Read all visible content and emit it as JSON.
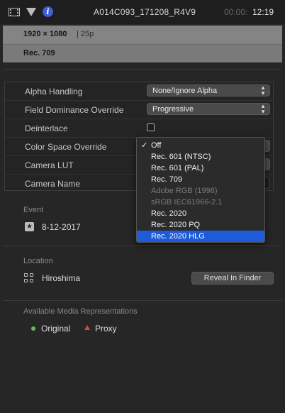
{
  "topbar": {
    "clip_title": "A014C093_171208_R4V9",
    "timecode_dim": "00:00:",
    "timecode": "12:19",
    "icons": [
      "film-icon",
      "filter-triangle-icon",
      "info-icon"
    ]
  },
  "summary": {
    "resolution": "1920 × 1080",
    "frame_rate": "| 25p",
    "color_space": "Rec. 709"
  },
  "settings": {
    "alpha_label": "Alpha Handling",
    "alpha_value": "None/Ignore Alpha",
    "field_label": "Field Dominance Override",
    "field_value": "Progressive",
    "deinterlace_label": "Deinterlace",
    "colorspace_label": "Color Space Override",
    "lut_label": "Camera LUT",
    "camname_label": "Camera Name"
  },
  "menu": {
    "check_mark": "✓",
    "items": [
      {
        "label": "Off",
        "state": "checked"
      },
      {
        "label": "Rec. 601 (NTSC)",
        "state": "enabled"
      },
      {
        "label": "Rec. 601 (PAL)",
        "state": "enabled"
      },
      {
        "label": "Rec. 709",
        "state": "enabled"
      },
      {
        "label": "Adobe RGB (1998)",
        "state": "disabled"
      },
      {
        "label": "sRGB IEC61966-2.1",
        "state": "disabled"
      },
      {
        "label": "Rec. 2020",
        "state": "enabled"
      },
      {
        "label": "Rec. 2020 PQ",
        "state": "enabled"
      },
      {
        "label": "Rec. 2020 HLG",
        "state": "highlighted"
      }
    ]
  },
  "event": {
    "label": "Event",
    "value": "8-12-2017"
  },
  "location": {
    "label": "Location",
    "value": "Hiroshima",
    "reveal_button": "Reveal In Finder"
  },
  "media": {
    "label": "Available Media Representations",
    "original": "Original",
    "proxy": "Proxy"
  },
  "colors": {
    "accent": "#1e5bd8",
    "original_dot": "#5fbf55",
    "proxy_marker": "#e0463a"
  }
}
